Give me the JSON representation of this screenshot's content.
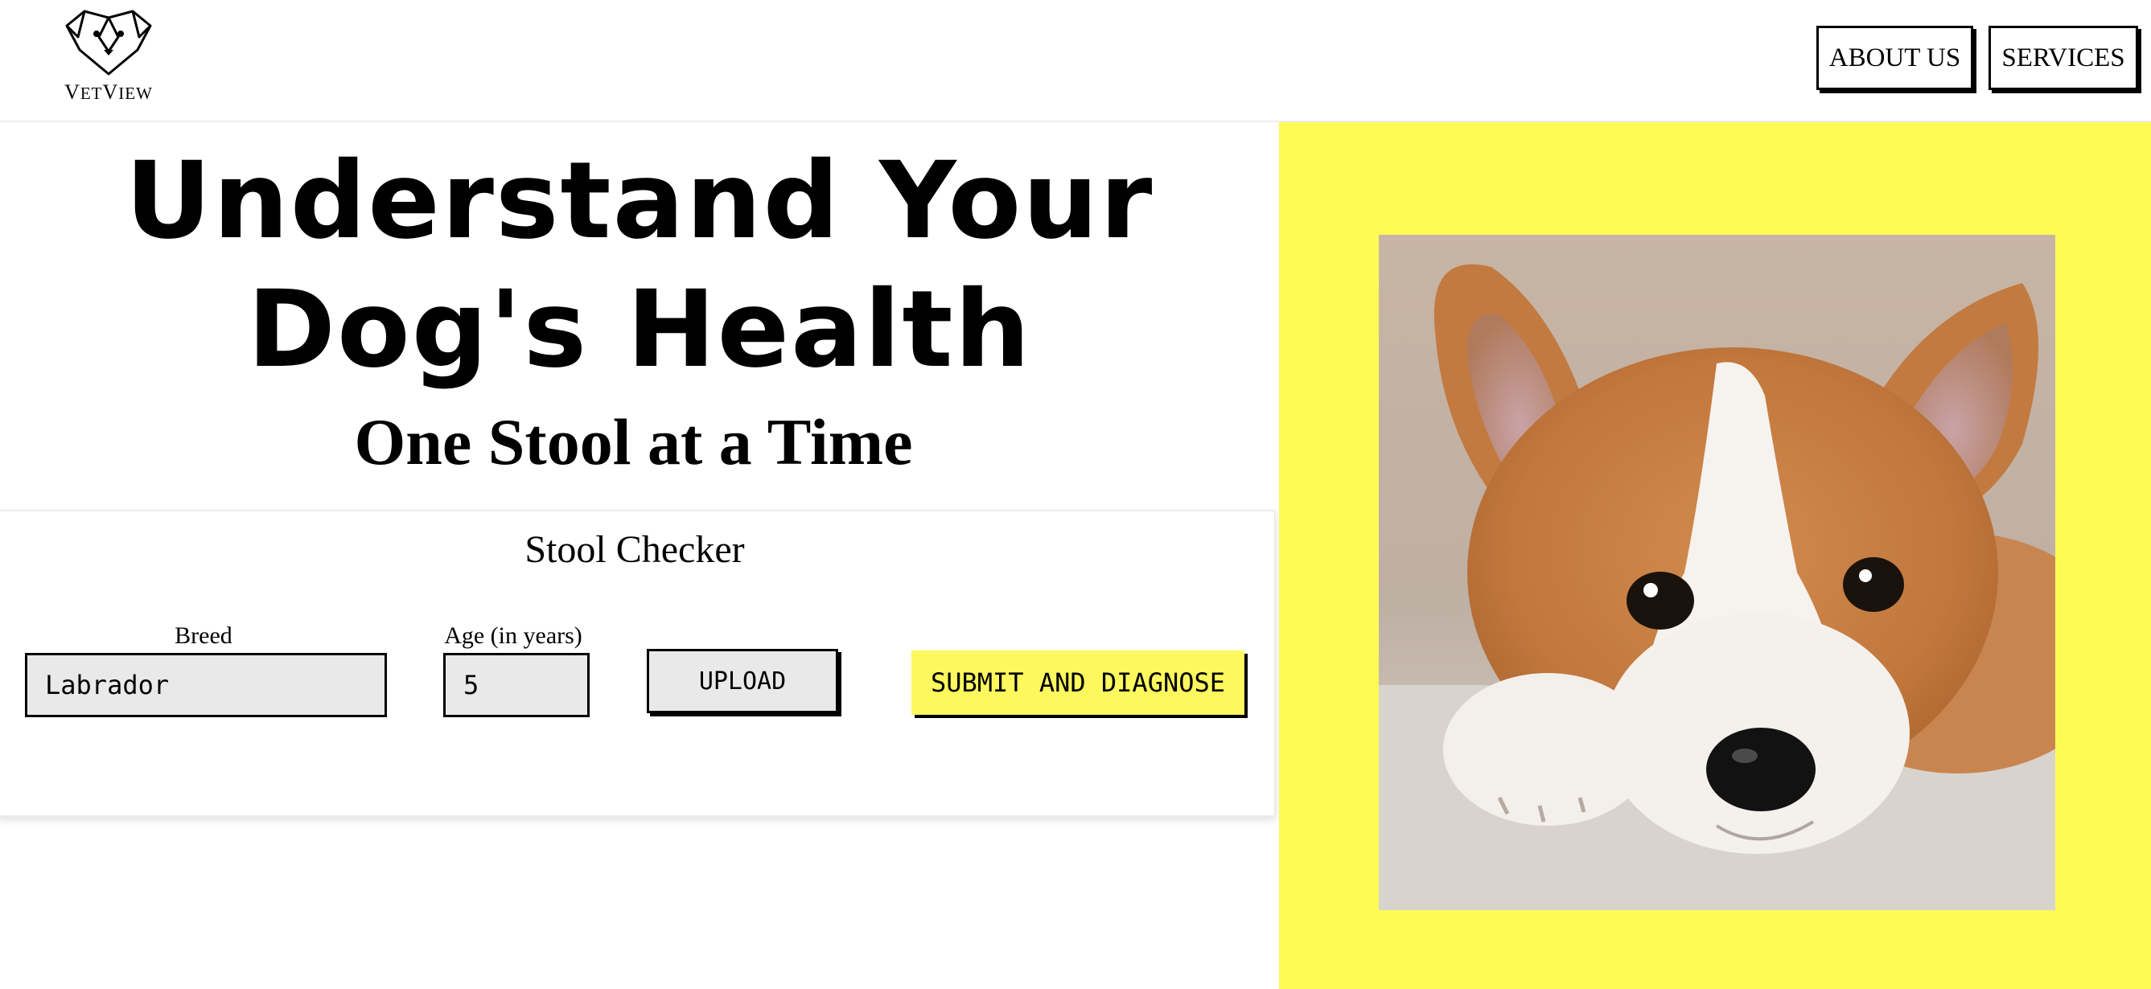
{
  "header": {
    "logo_text_big_v": "V",
    "logo_text_small_et": "ET",
    "logo_text_big_v2": "V",
    "logo_text_small_iew": "IEW",
    "nav": [
      {
        "label": "ABOUT US"
      },
      {
        "label": "SERVICES"
      }
    ]
  },
  "hero": {
    "title_line1": "Understand Your",
    "title_line2": "Dog's Health",
    "subtitle": "One Stool at a Time"
  },
  "checker": {
    "title": "Stool Checker",
    "breed_label": "Breed",
    "breed_value": "Labrador",
    "age_label": "Age (in years)",
    "age_value": "5",
    "upload_label": "UPLOAD",
    "submit_label": "SUBMIT AND DIAGNOSE"
  },
  "colors": {
    "accent_yellow": "#fffb55",
    "button_yellow": "#fcf85e",
    "field_gray": "#e9e9e9"
  },
  "icons": {
    "logo": "dog-face-icon",
    "photo": "corgi-puppy-image"
  }
}
